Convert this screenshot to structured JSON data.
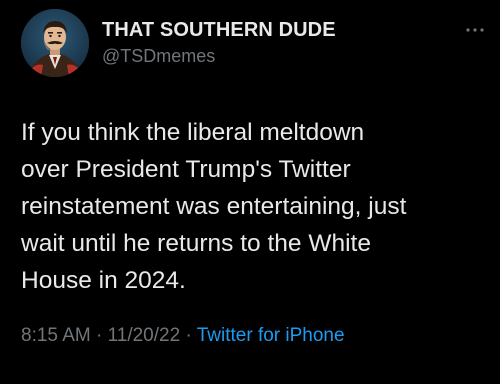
{
  "author": {
    "display_name": "THAT SOUTHERN DUDE",
    "handle": "@TSDmemes",
    "avatar_icon": "profile-avatar"
  },
  "more_icon": "more-options-icon",
  "tweet": {
    "text": "If you think the liberal meltdown\nover President Trump's Twitter\nreinstatement was entertaining, just\nwait until he returns to the White\nHouse in 2024."
  },
  "meta": {
    "time": "8:15 AM",
    "separator": "·",
    "date": "11/20/22",
    "source": "Twitter for iPhone"
  },
  "colors": {
    "background": "#000000",
    "text_primary": "#e7e9ea",
    "text_secondary": "#71767b",
    "link": "#1d9bf0"
  }
}
